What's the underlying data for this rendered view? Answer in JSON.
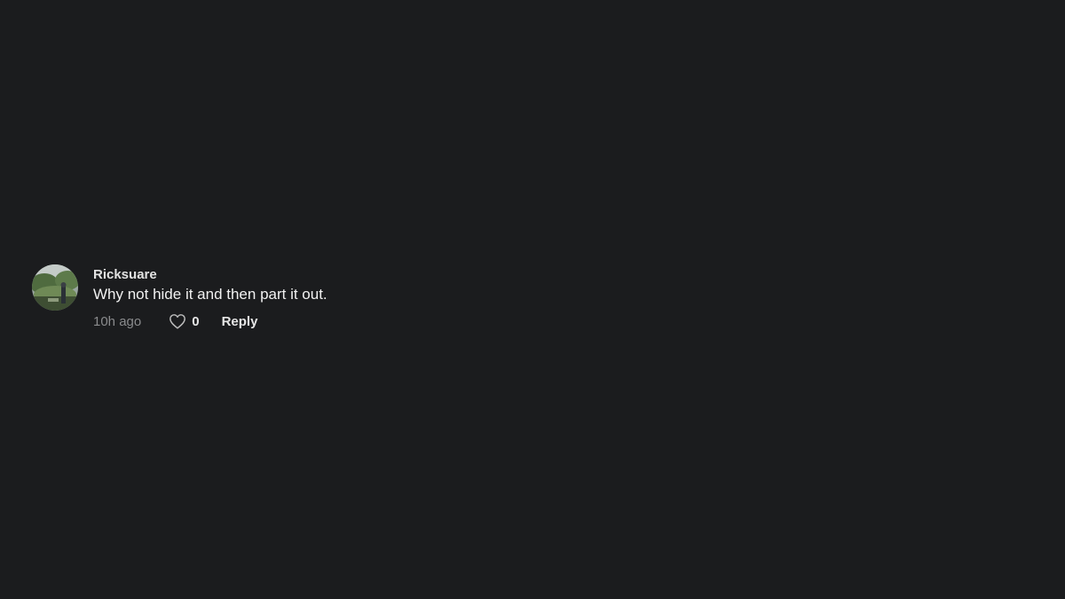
{
  "comment": {
    "username": "Ricksuare",
    "text": "Why not hide it and then part it out.",
    "time": "10h ago",
    "likes": "0",
    "reply_label": "Reply",
    "like_icon": "heart-outline"
  },
  "colors": {
    "background": "#1b1c1e",
    "text_primary": "#f1f1f1",
    "text_muted": "#8a8b8d"
  }
}
